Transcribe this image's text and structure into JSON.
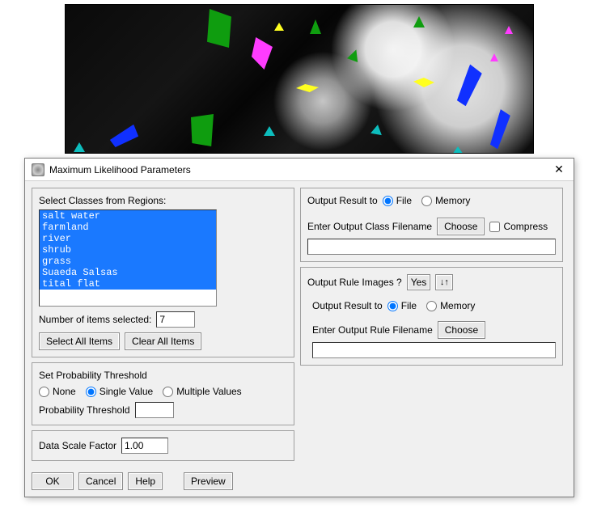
{
  "dialog": {
    "title": "Maximum Likelihood Parameters",
    "close_glyph": "✕"
  },
  "classes_panel": {
    "label": "Select Classes from Regions:",
    "items": [
      "salt water",
      "farmland",
      "river",
      "shrub",
      "grass",
      "Suaeda Salsas",
      "tital flat"
    ],
    "count_label": "Number of items selected:",
    "count_value": "7",
    "select_all_label": "Select All Items",
    "clear_all_label": "Clear All Items"
  },
  "threshold_panel": {
    "heading": "Set Probability Threshold",
    "options": {
      "none": "None",
      "single": "Single Value",
      "multiple": "Multiple Values"
    },
    "prob_label": "Probability Threshold",
    "prob_value": ""
  },
  "scale_panel": {
    "label": "Data Scale Factor",
    "value": "1.00"
  },
  "output_class_panel": {
    "result_label": "Output Result to",
    "file_option": "File",
    "memory_option": "Memory",
    "filename_label": "Enter Output Class Filename",
    "choose_label": "Choose",
    "compress_label": "Compress",
    "filename_value": ""
  },
  "output_rule_panel": {
    "images_label": "Output Rule Images ?",
    "toggle_value": "Yes",
    "swap_glyph": "↓↑",
    "result_label": "Output Result to",
    "file_option": "File",
    "memory_option": "Memory",
    "filename_label": "Enter Output Rule Filename",
    "choose_label": "Choose",
    "filename_value": ""
  },
  "buttons": {
    "ok": "OK",
    "cancel": "Cancel",
    "help": "Help",
    "preview": "Preview"
  }
}
